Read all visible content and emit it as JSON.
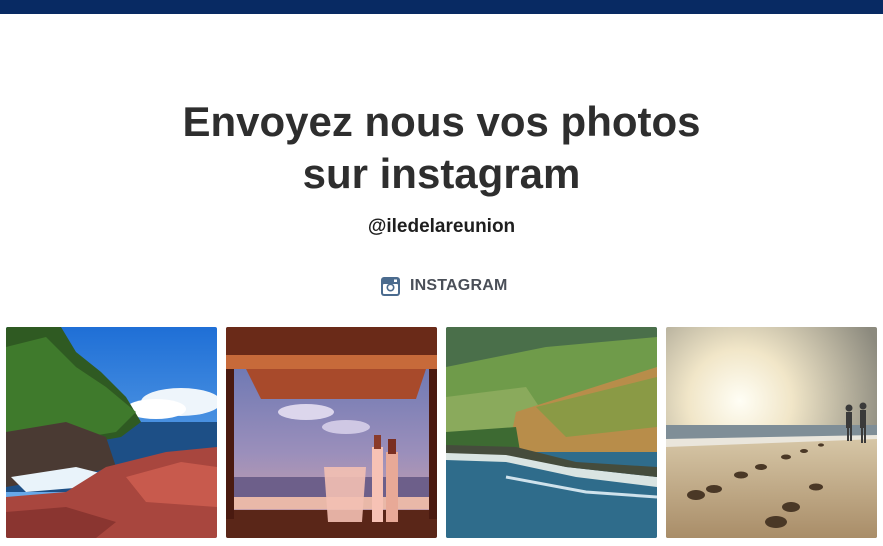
{
  "header": {
    "title_line1": "Envoyez nous vos photos",
    "title_line2": "sur instagram",
    "handle": "@iledelareunion"
  },
  "instagram_link": {
    "label": "INSTAGRAM",
    "icon": "instagram-icon",
    "icon_color": "#4b6b8e"
  },
  "colors": {
    "top_bar": "#082a63",
    "title_text": "#2e2e2e"
  },
  "photos": [
    {
      "subject": "coastal-cliff-red-rocks"
    },
    {
      "subject": "rose-wine-bucket-sunset"
    },
    {
      "subject": "green-coastal-cliff-road"
    },
    {
      "subject": "couple-walking-beach-footprints"
    }
  ]
}
